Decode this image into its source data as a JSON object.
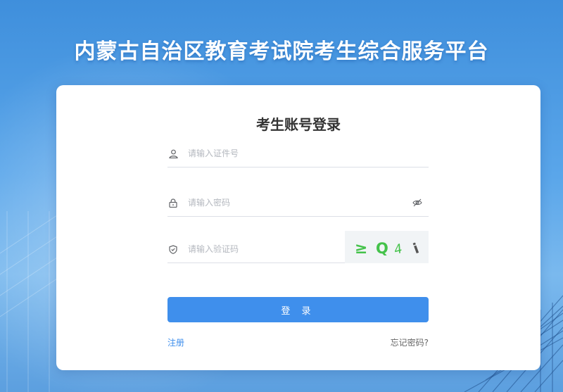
{
  "header": {
    "title": "内蒙古自治区教育考试院考生综合服务平台"
  },
  "login": {
    "title": "考生账号登录",
    "id_field": {
      "placeholder": "请输入证件号",
      "value": "",
      "icon": "user-icon"
    },
    "password_field": {
      "placeholder": "请输入密码",
      "value": "",
      "icon": "lock-icon",
      "toggle_icon": "eye-slash-icon"
    },
    "captcha_field": {
      "placeholder": "请输入验证码",
      "value": "",
      "icon": "shield-icon"
    },
    "captcha_image": {
      "chars": [
        "≥",
        "Q",
        "4",
        "i"
      ],
      "colors": [
        "#44c24a",
        "#44c24a",
        "#44c24a",
        "#555555"
      ]
    },
    "submit_label": "登 录",
    "register_link": "注册",
    "forgot_link": "忘记密码?"
  },
  "colors": {
    "primary": "#3f8fec",
    "background": "#4a97e0"
  }
}
